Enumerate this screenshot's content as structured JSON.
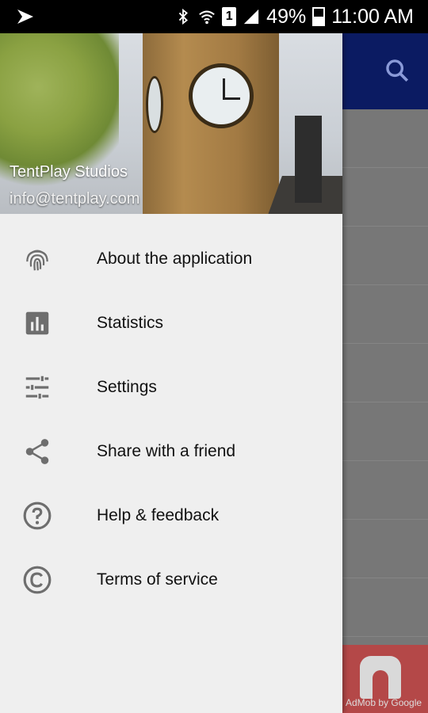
{
  "status_bar": {
    "battery": "49%",
    "time": "11:00 AM",
    "sim_slot": "1"
  },
  "drawer": {
    "header": {
      "name": "TentPlay Studios",
      "email": "info@tentplay.com"
    },
    "items": [
      {
        "label": "About the application",
        "icon": "fingerprint-icon"
      },
      {
        "label": "Statistics",
        "icon": "bar-chart-icon"
      },
      {
        "label": "Settings",
        "icon": "tune-sliders-icon"
      },
      {
        "label": "Share with a friend",
        "icon": "share-icon"
      },
      {
        "label": "Help & feedback",
        "icon": "help-circle-icon"
      },
      {
        "label": "Terms of service",
        "icon": "copyright-icon"
      }
    ]
  },
  "background_app": {
    "ad_text": "AdMob by Google",
    "toolbar_color": "#0b1b62"
  },
  "colors": {
    "drawer_bg": "#efefef",
    "icon_gray": "#6e6e6e",
    "text": "#111111"
  }
}
